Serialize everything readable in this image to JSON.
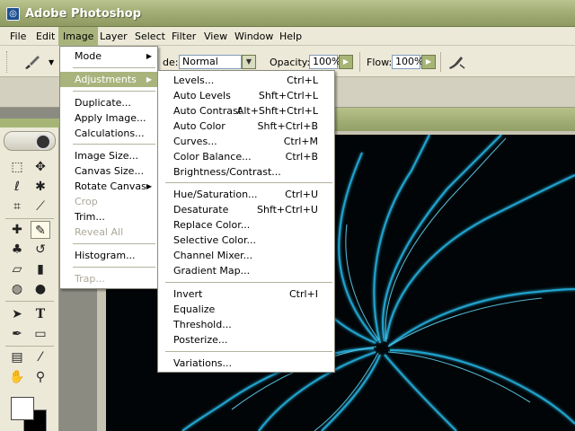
{
  "window": {
    "title": "Adobe Photoshop",
    "icon": "photoshop-app-icon"
  },
  "menubar": {
    "items": [
      "File",
      "Edit",
      "Image",
      "Layer",
      "Select",
      "Filter",
      "View",
      "Window",
      "Help"
    ],
    "active": "Image"
  },
  "options": {
    "mode_label": "de:",
    "mode_value": "Normal",
    "opacity_label": "Opacity:",
    "opacity_value": "100%",
    "flow_label": "Flow:",
    "flow_value": "100%"
  },
  "image_menu": {
    "items": [
      {
        "label": "Mode",
        "submenu": true,
        "enabled": true
      },
      {
        "label": "Adjustments",
        "submenu": true,
        "enabled": true,
        "highlighted": true
      },
      {
        "label": "Duplicate...",
        "enabled": true
      },
      {
        "label": "Apply Image...",
        "enabled": true
      },
      {
        "label": "Calculations...",
        "enabled": true
      },
      {
        "label": "Image Size...",
        "enabled": true
      },
      {
        "label": "Canvas Size...",
        "enabled": true
      },
      {
        "label": "Rotate Canvas",
        "submenu": true,
        "enabled": true
      },
      {
        "label": "Crop",
        "enabled": false
      },
      {
        "label": "Trim...",
        "enabled": true
      },
      {
        "label": "Reveal All",
        "enabled": false
      },
      {
        "label": "Histogram...",
        "enabled": true
      },
      {
        "label": "Trap...",
        "enabled": false
      }
    ]
  },
  "adjustments_menu": {
    "items": [
      {
        "label": "Levels...",
        "shortcut": "Ctrl+L"
      },
      {
        "label": "Auto Levels",
        "shortcut": "Shft+Ctrl+L"
      },
      {
        "label": "Auto Contrast",
        "shortcut": "Alt+Shft+Ctrl+L"
      },
      {
        "label": "Auto Color",
        "shortcut": "Shft+Ctrl+B"
      },
      {
        "label": "Curves...",
        "shortcut": "Ctrl+M"
      },
      {
        "label": "Color Balance...",
        "shortcut": "Ctrl+B"
      },
      {
        "label": "Brightness/Contrast...",
        "shortcut": ""
      },
      {
        "label": "Hue/Saturation...",
        "shortcut": "Ctrl+U"
      },
      {
        "label": "Desaturate",
        "shortcut": "Shft+Ctrl+U"
      },
      {
        "label": "Replace Color...",
        "shortcut": ""
      },
      {
        "label": "Selective Color...",
        "shortcut": ""
      },
      {
        "label": "Channel Mixer...",
        "shortcut": ""
      },
      {
        "label": "Gradient Map...",
        "shortcut": ""
      },
      {
        "label": "Invert",
        "shortcut": "Ctrl+I"
      },
      {
        "label": "Equalize",
        "shortcut": ""
      },
      {
        "label": "Threshold...",
        "shortcut": ""
      },
      {
        "label": "Posterize...",
        "shortcut": ""
      },
      {
        "label": "Variations...",
        "shortcut": ""
      }
    ]
  },
  "toolbox": {
    "tools": [
      "marquee-tool",
      "move-tool",
      "lasso-tool",
      "magic-wand-tool",
      "crop-tool",
      "slice-tool",
      "healing-brush-tool",
      "brush-tool",
      "clone-stamp-tool",
      "history-brush-tool",
      "eraser-tool",
      "gradient-tool",
      "blur-tool",
      "dodge-tool",
      "path-selection-tool",
      "type-tool",
      "pen-tool",
      "shape-tool",
      "notes-tool",
      "eyedropper-tool",
      "hand-tool",
      "zoom-tool"
    ],
    "active": "brush-tool",
    "foreground_color": "#ffffff",
    "background_color": "#000000"
  },
  "colors": {
    "accent": "#a9b47d",
    "canvas_glow": "#29b6e0"
  }
}
